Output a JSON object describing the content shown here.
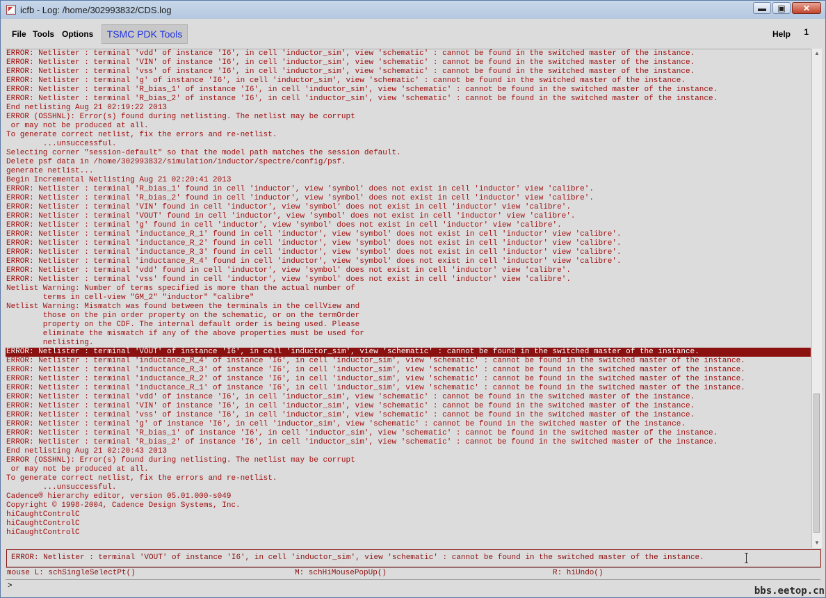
{
  "window": {
    "title": "icfb - Log: /home/302993832/CDS.log",
    "buttons": {
      "minimize": "▬",
      "maximize": "▣",
      "close": "✕"
    }
  },
  "menu": {
    "file": "File",
    "tools": "Tools",
    "options": "Options",
    "tsmc": "TSMC PDK Tools",
    "help": "Help",
    "window_number": "1"
  },
  "log": {
    "lines": [
      {
        "text": "ERROR: Netlister : terminal 'vdd' of instance 'I6', in cell 'inductor_sim', view 'schematic' : cannot be found in the switched master of the instance.",
        "highlighted": false
      },
      {
        "text": "ERROR: Netlister : terminal 'VIN' of instance 'I6', in cell 'inductor_sim', view 'schematic' : cannot be found in the switched master of the instance.",
        "highlighted": false
      },
      {
        "text": "ERROR: Netlister : terminal 'vss' of instance 'I6', in cell 'inductor_sim', view 'schematic' : cannot be found in the switched master of the instance.",
        "highlighted": false
      },
      {
        "text": "ERROR: Netlister : terminal 'g' of instance 'I6', in cell 'inductor_sim', view 'schematic' : cannot be found in the switched master of the instance.",
        "highlighted": false
      },
      {
        "text": "ERROR: Netlister : terminal 'R_bias_1' of instance 'I6', in cell 'inductor_sim', view 'schematic' : cannot be found in the switched master of the instance.",
        "highlighted": false
      },
      {
        "text": "ERROR: Netlister : terminal 'R_bias_2' of instance 'I6', in cell 'inductor_sim', view 'schematic' : cannot be found in the switched master of the instance.",
        "highlighted": false
      },
      {
        "text": "End netlisting Aug 21 02:19:22 2013",
        "highlighted": false
      },
      {
        "text": "ERROR (OSSHNL): Error(s) found during netlisting. The netlist may be corrupt",
        "highlighted": false
      },
      {
        "text": " or may not be produced at all.",
        "highlighted": false
      },
      {
        "text": "To generate correct netlist, fix the errors and re-netlist.",
        "highlighted": false
      },
      {
        "text": "        ...unsuccessful.",
        "highlighted": false
      },
      {
        "text": "Selecting corner \"session-default\" so that the model path matches the session default.",
        "highlighted": false
      },
      {
        "text": "Delete psf data in /home/302993832/simulation/inductor/spectre/config/psf.",
        "highlighted": false
      },
      {
        "text": "generate netlist...",
        "highlighted": false
      },
      {
        "text": "Begin Incremental Netlisting Aug 21 02:20:41 2013",
        "highlighted": false
      },
      {
        "text": "ERROR: Netlister : terminal 'R_bias_1' found in cell 'inductor', view 'symbol' does not exist in cell 'inductor' view 'calibre'.",
        "highlighted": false
      },
      {
        "text": "ERROR: Netlister : terminal 'R_bias_2' found in cell 'inductor', view 'symbol' does not exist in cell 'inductor' view 'calibre'.",
        "highlighted": false
      },
      {
        "text": "ERROR: Netlister : terminal 'VIN' found in cell 'inductor', view 'symbol' does not exist in cell 'inductor' view 'calibre'.",
        "highlighted": false
      },
      {
        "text": "ERROR: Netlister : terminal 'VOUT' found in cell 'inductor', view 'symbol' does not exist in cell 'inductor' view 'calibre'.",
        "highlighted": false
      },
      {
        "text": "ERROR: Netlister : terminal 'g' found in cell 'inductor', view 'symbol' does not exist in cell 'inductor' view 'calibre'.",
        "highlighted": false
      },
      {
        "text": "ERROR: Netlister : terminal 'inductance_R_1' found in cell 'inductor', view 'symbol' does not exist in cell 'inductor' view 'calibre'.",
        "highlighted": false
      },
      {
        "text": "ERROR: Netlister : terminal 'inductance_R_2' found in cell 'inductor', view 'symbol' does not exist in cell 'inductor' view 'calibre'.",
        "highlighted": false
      },
      {
        "text": "ERROR: Netlister : terminal 'inductance_R_3' found in cell 'inductor', view 'symbol' does not exist in cell 'inductor' view 'calibre'.",
        "highlighted": false
      },
      {
        "text": "ERROR: Netlister : terminal 'inductance_R_4' found in cell 'inductor', view 'symbol' does not exist in cell 'inductor' view 'calibre'.",
        "highlighted": false
      },
      {
        "text": "ERROR: Netlister : terminal 'vdd' found in cell 'inductor', view 'symbol' does not exist in cell 'inductor' view 'calibre'.",
        "highlighted": false
      },
      {
        "text": "ERROR: Netlister : terminal 'vss' found in cell 'inductor', view 'symbol' does not exist in cell 'inductor' view 'calibre'.",
        "highlighted": false
      },
      {
        "text": "Netlist Warning: Number of terms specified is more than the actual number of",
        "highlighted": false
      },
      {
        "text": "        terms in cell-view \"GM_2\" \"inductor\" \"calibre\"",
        "highlighted": false
      },
      {
        "text": "Netlist Warning: Mismatch was found between the terminals in the cellView and",
        "highlighted": false
      },
      {
        "text": "        those on the pin order property on the schematic, or on the termOrder",
        "highlighted": false
      },
      {
        "text": "        property on the CDF. The internal default order is being used. Please",
        "highlighted": false
      },
      {
        "text": "        eliminate the mismatch if any of the above properties must be used for",
        "highlighted": false
      },
      {
        "text": "        netlisting.",
        "highlighted": false
      },
      {
        "text": "ERROR: Netlister : terminal 'VOUT' of instance 'I6', in cell 'inductor_sim', view 'schematic' : cannot be found in the switched master of the instance.",
        "highlighted": true
      },
      {
        "text": "ERROR: Netlister : terminal 'inductance_R_4' of instance 'I6', in cell 'inductor_sim', view 'schematic' : cannot be found in the switched master of the instance.",
        "highlighted": false
      },
      {
        "text": "ERROR: Netlister : terminal 'inductance_R_3' of instance 'I6', in cell 'inductor_sim', view 'schematic' : cannot be found in the switched master of the instance.",
        "highlighted": false
      },
      {
        "text": "ERROR: Netlister : terminal 'inductance_R_2' of instance 'I6', in cell 'inductor_sim', view 'schematic' : cannot be found in the switched master of the instance.",
        "highlighted": false
      },
      {
        "text": "ERROR: Netlister : terminal 'inductance_R_1' of instance 'I6', in cell 'inductor_sim', view 'schematic' : cannot be found in the switched master of the instance.",
        "highlighted": false
      },
      {
        "text": "ERROR: Netlister : terminal 'vdd' of instance 'I6', in cell 'inductor_sim', view 'schematic' : cannot be found in the switched master of the instance.",
        "highlighted": false
      },
      {
        "text": "ERROR: Netlister : terminal 'VIN' of instance 'I6', in cell 'inductor_sim', view 'schematic' : cannot be found in the switched master of the instance.",
        "highlighted": false
      },
      {
        "text": "ERROR: Netlister : terminal 'vss' of instance 'I6', in cell 'inductor_sim', view 'schematic' : cannot be found in the switched master of the instance.",
        "highlighted": false
      },
      {
        "text": "ERROR: Netlister : terminal 'g' of instance 'I6', in cell 'inductor_sim', view 'schematic' : cannot be found in the switched master of the instance.",
        "highlighted": false
      },
      {
        "text": "ERROR: Netlister : terminal 'R_bias_1' of instance 'I6', in cell 'inductor_sim', view 'schematic' : cannot be found in the switched master of the instance.",
        "highlighted": false
      },
      {
        "text": "ERROR: Netlister : terminal 'R_bias_2' of instance 'I6', in cell 'inductor_sim', view 'schematic' : cannot be found in the switched master of the instance.",
        "highlighted": false
      },
      {
        "text": "End netlisting Aug 21 02:20:43 2013",
        "highlighted": false
      },
      {
        "text": "ERROR (OSSHNL): Error(s) found during netlisting. The netlist may be corrupt",
        "highlighted": false
      },
      {
        "text": " or may not be produced at all.",
        "highlighted": false
      },
      {
        "text": "To generate correct netlist, fix the errors and re-netlist.",
        "highlighted": false
      },
      {
        "text": "        ...unsuccessful.",
        "highlighted": false
      },
      {
        "text": "Cadence® hierarchy editor, version 05.01.000-s049",
        "highlighted": false
      },
      {
        "text": "Copyright © 1998-2004, Cadence Design Systems, Inc.",
        "highlighted": false
      },
      {
        "text": "hiCaughtControlC",
        "highlighted": false
      },
      {
        "text": "hiCaughtControlC",
        "highlighted": false
      },
      {
        "text": "hiCaughtControlC",
        "highlighted": false
      }
    ]
  },
  "command_field": {
    "value": "ERROR: Netlister : terminal 'VOUT' of instance 'I6', in cell 'inductor_sim', view 'schematic' : cannot be found in the switched master of the instance."
  },
  "mouse_bindings": {
    "left": "mouse L: schSingleSelectPt()",
    "middle": "M: schHiMousePopUp()",
    "right": "R: hiUndo()"
  },
  "prompt": ">",
  "watermark": "bbs.eetop.cn",
  "colors": {
    "log_text": "#a01010",
    "highlight_bg": "#8b1010",
    "menu_tsmc_text": "#2030e0"
  }
}
